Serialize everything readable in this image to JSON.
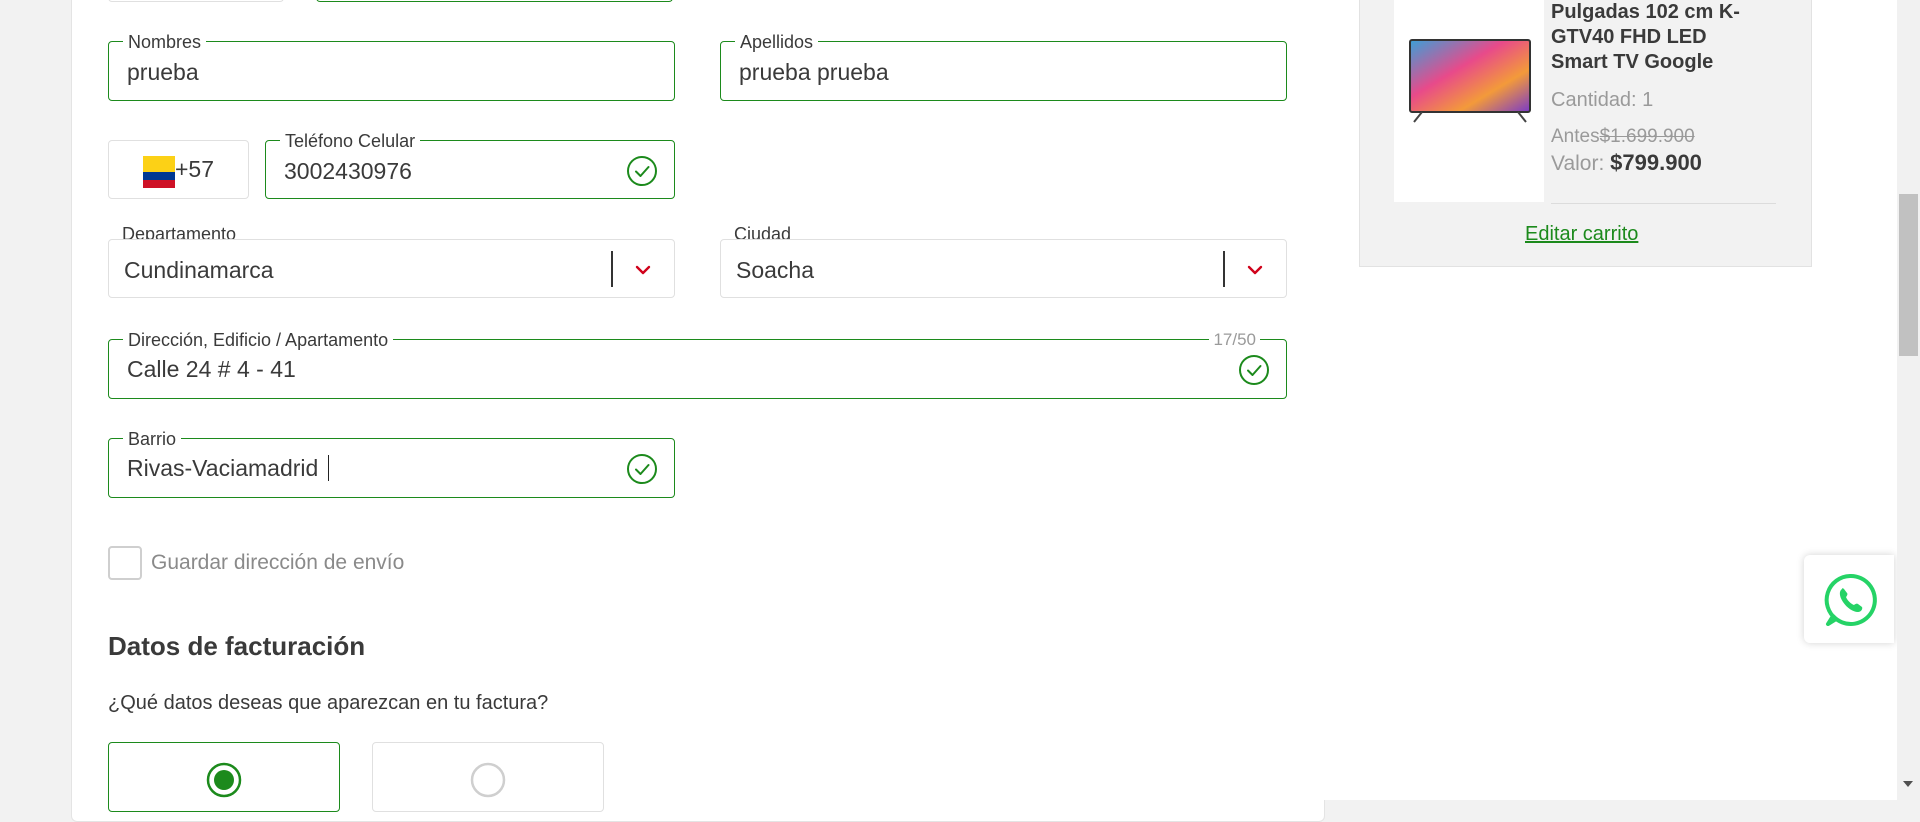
{
  "form": {
    "first_name": {
      "label": "Nombres",
      "value": "prueba"
    },
    "last_name": {
      "label": "Apellidos",
      "value": "prueba prueba"
    },
    "phone_code": "+57",
    "phone": {
      "label": "Teléfono Celular",
      "value": "3002430976"
    },
    "department": {
      "label": "Departamento",
      "value": "Cundinamarca"
    },
    "city": {
      "label": "Ciudad",
      "value": "Soacha"
    },
    "address": {
      "label": "Dirección, Edificio / Apartamento",
      "value": "Calle 24 # 4 - 41",
      "counter": "17/50"
    },
    "neighborhood": {
      "label": "Barrio",
      "value": "Rivas-Vaciamadrid"
    },
    "save_address_label": "Guardar dirección de envío"
  },
  "billing": {
    "title": "Datos de facturación",
    "question": "¿Qué datos deseas que aparezcan en tu factura?"
  },
  "cart": {
    "product_name": "Pulgadas 102 cm K-GTV40 FHD LED Smart TV Google",
    "quantity": "Cantidad: 1",
    "before_label": "Antes",
    "before_price": "$1.699.900",
    "value_label": "Valor:",
    "value_price": "$799.900",
    "edit_link": "Editar carrito"
  },
  "colors": {
    "accent_green": "#1c8a1c",
    "chevron_red": "#d0021b",
    "whatsapp_green": "#25d366"
  },
  "icons": {
    "valid": "check-circle-icon",
    "dropdown": "chevron-down-icon",
    "whatsapp": "whatsapp-icon",
    "flag": "colombia-flag-icon"
  }
}
